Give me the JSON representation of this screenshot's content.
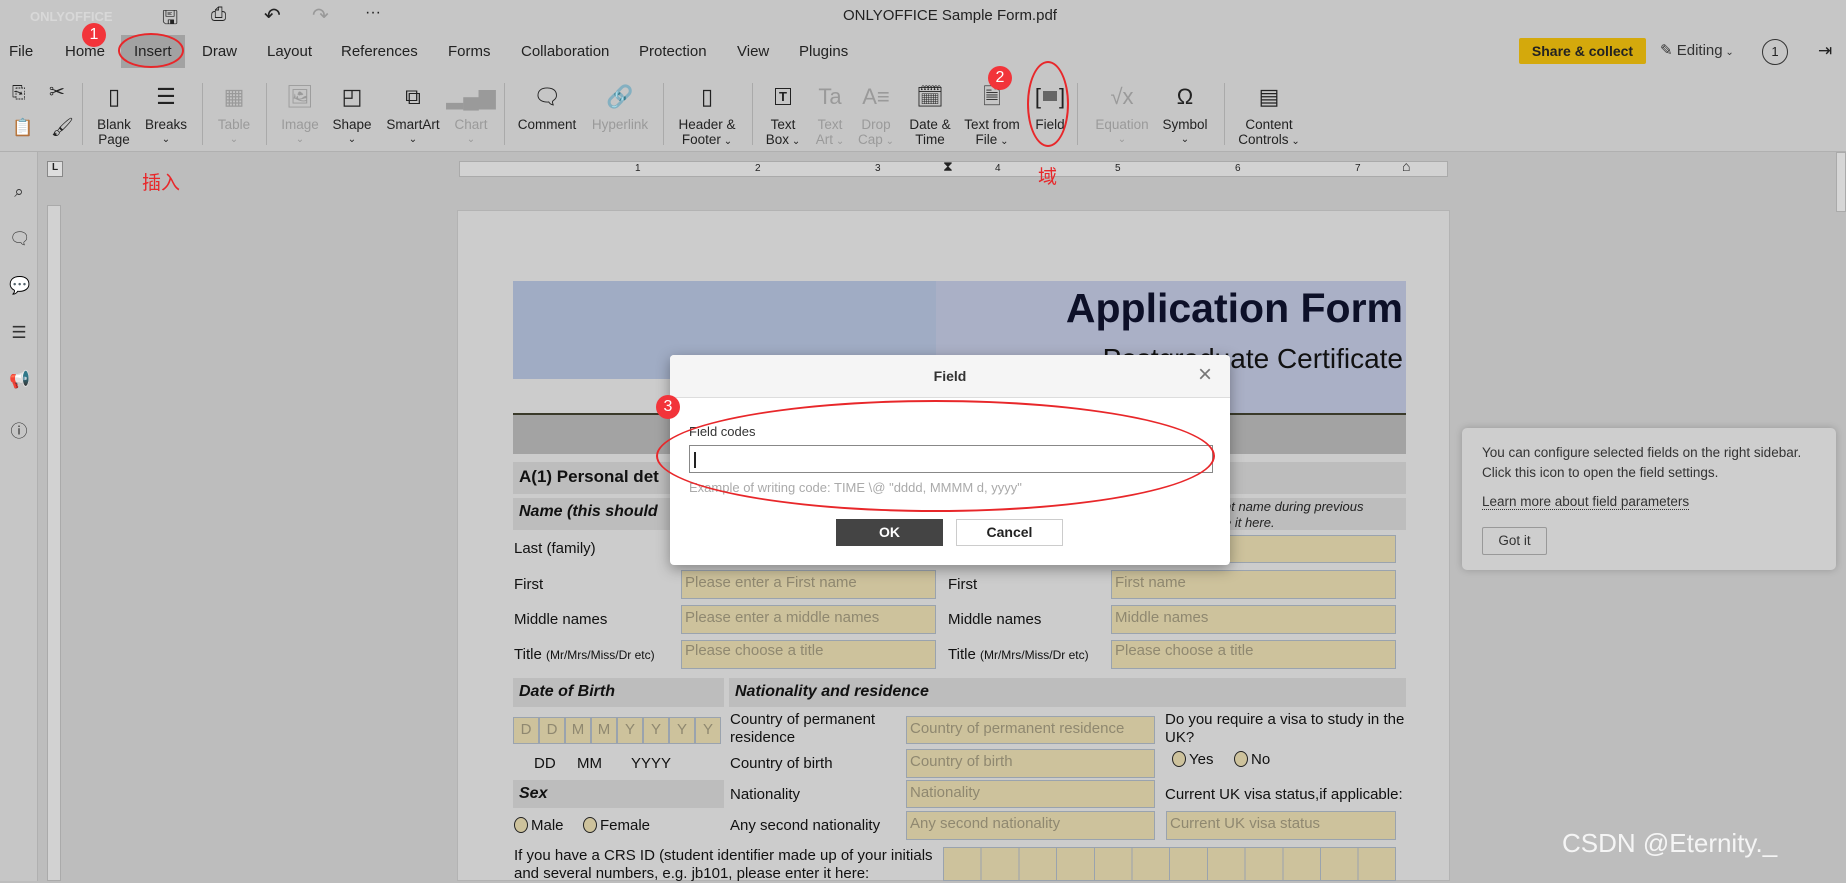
{
  "app": {
    "title": "ONLYOFFICE Sample Form.pdf",
    "logo": "ONLYOFFICE"
  },
  "menu": {
    "tabs": [
      "File",
      "Home",
      "Insert",
      "Draw",
      "Layout",
      "References",
      "Forms",
      "Collaboration",
      "Protection",
      "View",
      "Plugins"
    ],
    "active": "Insert"
  },
  "header_right": {
    "share": "Share & collect",
    "editing": "Editing",
    "users_count": "1"
  },
  "toolbar": {
    "blank_page": [
      "Blank",
      "Page"
    ],
    "breaks": "Breaks",
    "table": "Table",
    "image": "Image",
    "shape": "Shape",
    "smartart": "SmartArt",
    "chart": "Chart",
    "comment": "Comment",
    "hyperlink": "Hyperlink",
    "header_footer": [
      "Header &",
      "Footer"
    ],
    "text_box": [
      "Text",
      "Box"
    ],
    "text_art": [
      "Text",
      "Art"
    ],
    "drop_cap": [
      "Drop",
      "Cap"
    ],
    "date_time": [
      "Date &",
      "Time"
    ],
    "text_from_file": [
      "Text from",
      "File"
    ],
    "field": "Field",
    "equation": "Equation",
    "symbol": "Symbol",
    "content_controls": [
      "Content",
      "Controls"
    ]
  },
  "ruler": {
    "numbers": [
      "1",
      "2",
      "3",
      "4",
      "5",
      "6",
      "7"
    ]
  },
  "form": {
    "title": "Application Form",
    "subtitle": "Postgraduate Certificate",
    "section_a1": "A(1) Personal det",
    "name_bar": "Name (this should",
    "name_note": [
      "nt name during previous",
      "e it here."
    ],
    "left_labels": [
      "Last (family)",
      "First",
      "Middle names",
      "Title"
    ],
    "title_hint": "(Mr/Mrs/Miss/Dr etc)",
    "left_fields": [
      "Please enter a First name",
      "Please enter a middle names",
      "Please choose a title"
    ],
    "right_labels": [
      "First",
      "Middle names",
      "Title"
    ],
    "right_fields": [
      "First name",
      "Middle names",
      "Please choose a title"
    ],
    "dob_bar": "Date of Birth",
    "dob_boxes": [
      "D",
      "D",
      "M",
      "M",
      "Y",
      "Y",
      "Y",
      "Y"
    ],
    "dob_legend": [
      "DD",
      "MM",
      "YYYY"
    ],
    "sex_bar": "Sex",
    "sex_options": [
      "Male",
      "Female"
    ],
    "nationality_bar": "Nationality and residence",
    "nat_labels": [
      "Country of permanent",
      "residence",
      "Country of birth",
      "Nationality",
      "Any second nationality"
    ],
    "nat_fields": [
      "Country of permanent residence",
      "Country of birth",
      "Nationality",
      "Any second nationality"
    ],
    "visa_question": [
      "Do you require a visa to study in the",
      "UK?"
    ],
    "visa_options": [
      "Yes",
      "No"
    ],
    "visa_status_label": "Current UK visa status,if applicable:",
    "visa_status_field": "Current UK visa status",
    "crs_text": [
      "If you have a CRS ID (student identifier made up of your initials",
      "and several numbers, e.g. jb101, please enter it here:"
    ]
  },
  "dialog": {
    "title": "Field",
    "label": "Field codes",
    "value": "",
    "example": "Example of writing code: TIME \\@ \"dddd, MMMM d, yyyy\"",
    "ok": "OK",
    "cancel": "Cancel"
  },
  "tip": {
    "text": [
      "You can configure selected fields on the right sidebar.",
      "Click this icon to open the field settings."
    ],
    "link": "Learn more about field parameters",
    "button": "Got it"
  },
  "annotations": {
    "badges": [
      "1",
      "2",
      "3"
    ],
    "insert_cn": "插入",
    "field_cn": "域"
  },
  "watermark": "CSDN @Eternity._",
  "colors": {
    "accent": "#d4a90c",
    "annotation": "#e8272a",
    "form_field": "#cdc29c",
    "header_blue": "#a0acc4"
  }
}
